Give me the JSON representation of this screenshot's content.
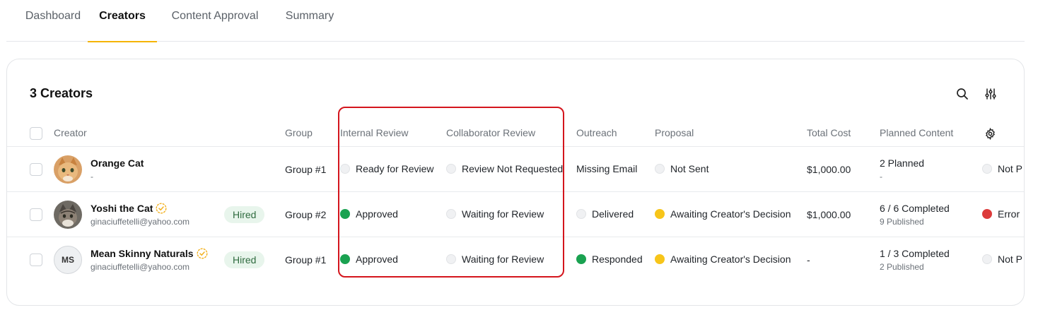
{
  "tabs": [
    {
      "label": "Dashboard",
      "active": false
    },
    {
      "label": "Creators",
      "active": true
    },
    {
      "label": "Content Approval",
      "active": false
    },
    {
      "label": "Summary",
      "active": false
    }
  ],
  "card": {
    "title": "3 Creators",
    "icons": [
      "search-icon",
      "filter-sliders-icon",
      "gear-icon"
    ]
  },
  "columns": {
    "creator": "Creator",
    "group": "Group",
    "internal_review": "Internal Review",
    "collaborator_review": "Collaborator Review",
    "outreach": "Outreach",
    "proposal": "Proposal",
    "total_cost": "Total Cost",
    "planned_content": "Planned Content"
  },
  "rows": [
    {
      "name": "Orange Cat",
      "sub": "-",
      "avatar": "cat-photo-orange",
      "badge": "",
      "verified": false,
      "group": "Group #1",
      "internal_review": {
        "text": "Ready for Review",
        "dot": "grey"
      },
      "collaborator_review": {
        "text": "Review Not Requested",
        "dot": "grey"
      },
      "outreach": {
        "text": "Missing Email",
        "dot": ""
      },
      "proposal": {
        "text": "Not Sent",
        "dot": "grey"
      },
      "total_cost": "$1,000.00",
      "planned_main": "2 Planned",
      "planned_sub": "-",
      "last": {
        "text": "Not P",
        "dot": "grey"
      }
    },
    {
      "name": "Yoshi the Cat",
      "sub": "ginaciuffetelli@yahoo.com",
      "avatar": "cat-photo-tabby",
      "badge": "Hired",
      "verified": true,
      "group": "Group #2",
      "internal_review": {
        "text": "Approved",
        "dot": "green"
      },
      "collaborator_review": {
        "text": "Waiting for Review",
        "dot": "grey"
      },
      "outreach": {
        "text": "Delivered",
        "dot": "grey"
      },
      "proposal": {
        "text": "Awaiting Creator's Decision",
        "dot": "yellow"
      },
      "total_cost": "$1,000.00",
      "planned_main": "6 / 6 Completed",
      "planned_sub": "9 Published",
      "last": {
        "text": "Error",
        "dot": "red"
      }
    },
    {
      "name": "Mean Skinny Naturals",
      "sub": "ginaciuffetelli@yahoo.com",
      "avatar": "MS",
      "badge": "Hired",
      "verified": true,
      "group": "Group #1",
      "internal_review": {
        "text": "Approved",
        "dot": "green"
      },
      "collaborator_review": {
        "text": "Waiting for Review",
        "dot": "grey"
      },
      "outreach": {
        "text": "Responded",
        "dot": "green"
      },
      "proposal": {
        "text": "Awaiting Creator's Decision",
        "dot": "yellow"
      },
      "total_cost": "-",
      "planned_main": "1 / 3 Completed",
      "planned_sub": "2 Published",
      "last": {
        "text": "Not P",
        "dot": "grey"
      }
    }
  ],
  "colors": {
    "accent_tab_underline": "#f5b400",
    "highlight_border": "#d4151d",
    "status_green": "#1aa251",
    "status_yellow": "#f7c51a",
    "status_red": "#dc3b3b",
    "badge_bg": "#e8f5ec"
  }
}
